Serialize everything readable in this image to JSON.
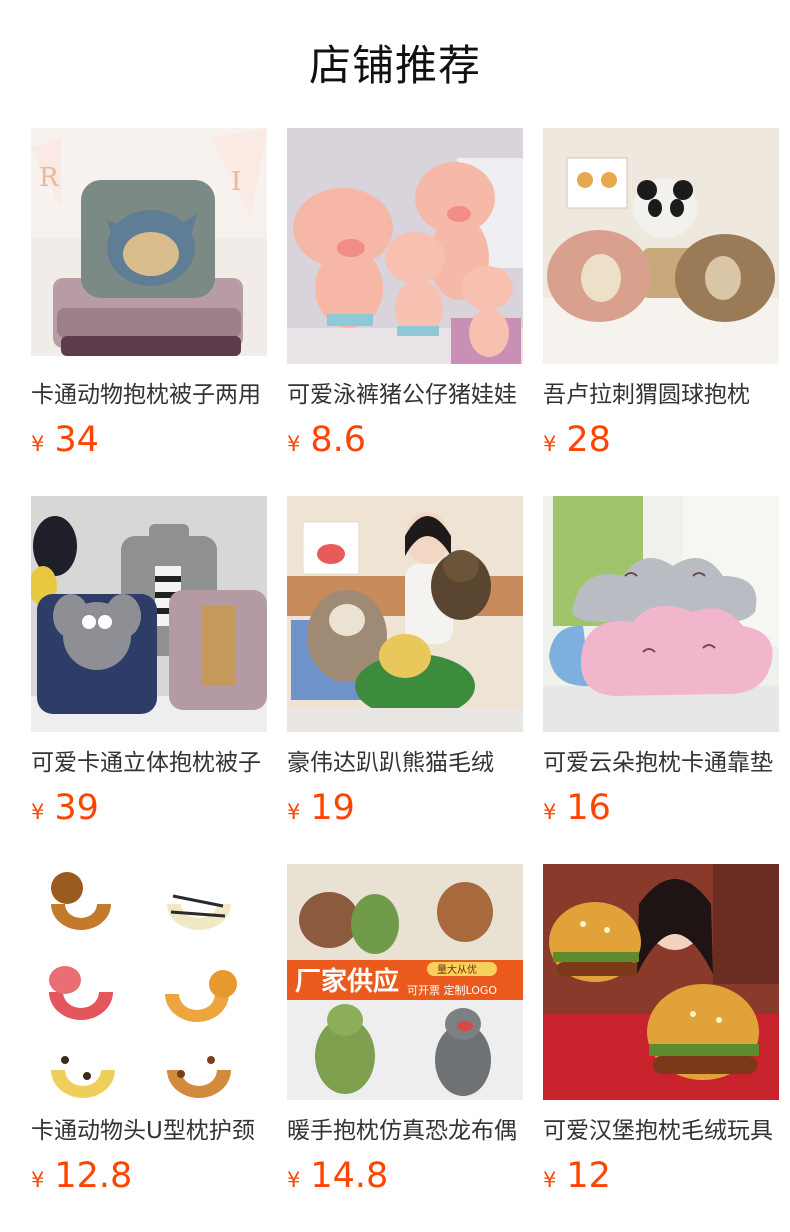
{
  "section": {
    "title": "店铺推荐"
  },
  "products": [
    {
      "name": "卡通动物抱枕被子两用",
      "currency": "¥",
      "price": "34"
    },
    {
      "name": "可爱泳裤猪公仔猪娃娃",
      "currency": "¥",
      "price": "8.6"
    },
    {
      "name": "吾卢拉刺猬圆球抱枕",
      "currency": "¥",
      "price": "28"
    },
    {
      "name": "可爱卡通立体抱枕被子",
      "currency": "¥",
      "price": "39"
    },
    {
      "name": "豪伟达趴趴熊猫毛绒",
      "currency": "¥",
      "price": "19"
    },
    {
      "name": "可爱云朵抱枕卡通靠垫",
      "currency": "¥",
      "price": "16"
    },
    {
      "name": "卡通动物头U型枕护颈",
      "currency": "¥",
      "price": "12.8"
    },
    {
      "name": "暖手抱枕仿真恐龙布偶",
      "currency": "¥",
      "price": "14.8"
    },
    {
      "name": "可爱汉堡抱枕毛绒玩具",
      "currency": "¥",
      "price": "12"
    }
  ],
  "image_banner": {
    "headline": "厂家供应",
    "tag1": "量大从优",
    "tag2": "可开票 定制LOGO"
  },
  "colors": {
    "price": "#ff4400",
    "title": "#111111",
    "text": "#333333"
  }
}
